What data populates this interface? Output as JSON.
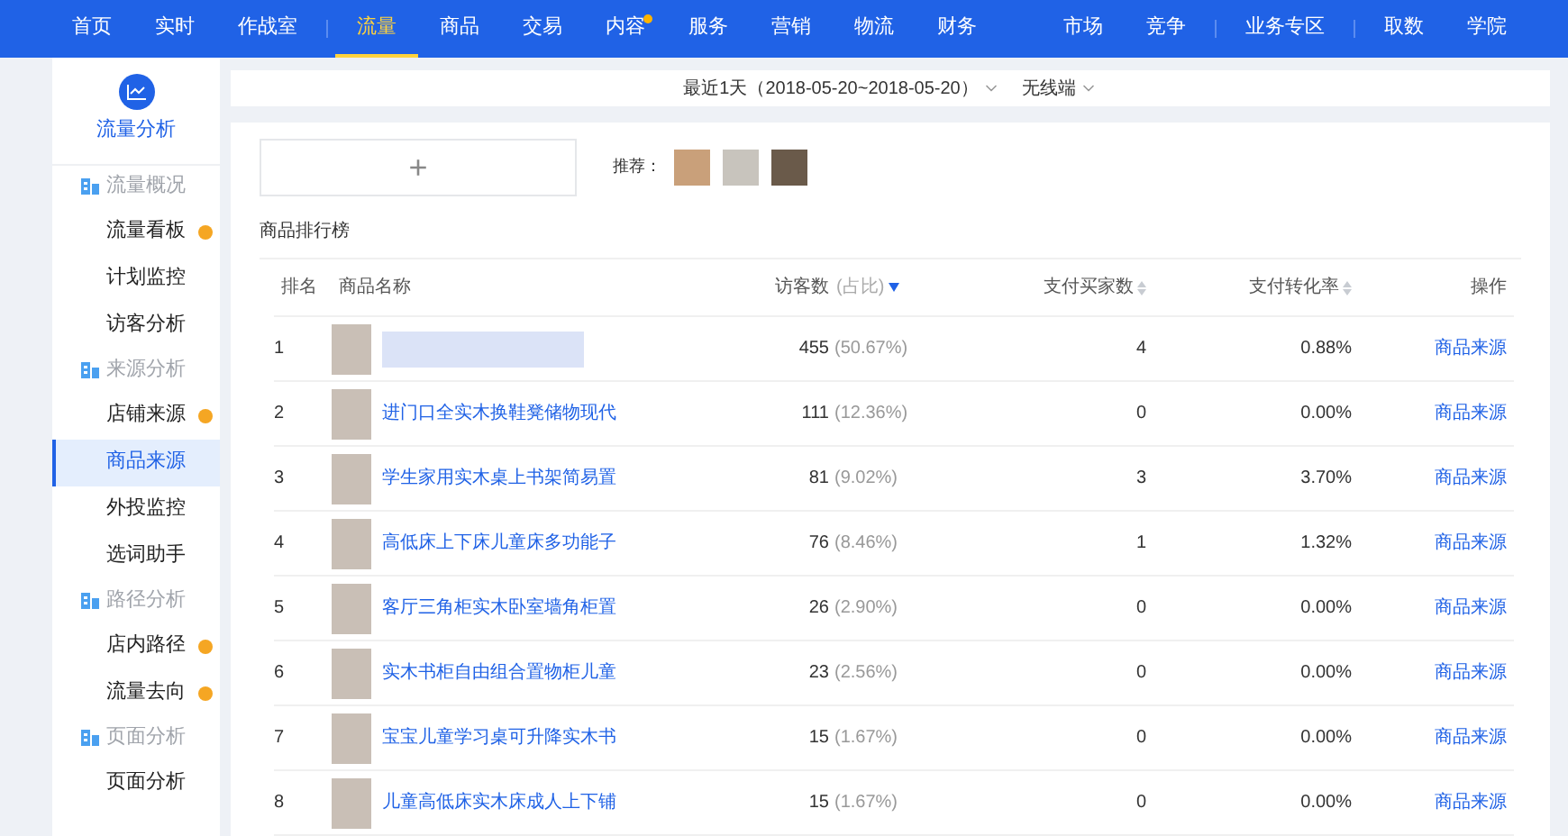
{
  "top_nav": {
    "groups": [
      [
        {
          "label": "首页",
          "selected": false,
          "dot": false
        },
        {
          "label": "实时",
          "selected": false,
          "dot": false
        },
        {
          "label": "作战室",
          "selected": false,
          "dot": false
        }
      ],
      [
        {
          "label": "流量",
          "selected": true,
          "dot": false
        },
        {
          "label": "商品",
          "selected": false,
          "dot": false
        },
        {
          "label": "交易",
          "selected": false,
          "dot": false
        },
        {
          "label": "内容",
          "selected": false,
          "dot": true
        },
        {
          "label": "服务",
          "selected": false,
          "dot": false
        },
        {
          "label": "营销",
          "selected": false,
          "dot": false
        },
        {
          "label": "物流",
          "selected": false,
          "dot": false
        },
        {
          "label": "财务",
          "selected": false,
          "dot": false
        }
      ],
      [
        {
          "label": "市场",
          "selected": false,
          "dot": false
        },
        {
          "label": "竞争",
          "selected": false,
          "dot": false
        }
      ],
      [
        {
          "label": "业务专区",
          "selected": false,
          "dot": false
        }
      ],
      [
        {
          "label": "取数",
          "selected": false,
          "dot": false
        },
        {
          "label": "学院",
          "selected": false,
          "dot": false
        }
      ]
    ],
    "dividers_after": [
      true,
      false,
      true,
      true
    ]
  },
  "sidebar": {
    "title": "流量分析",
    "sections": [
      {
        "title": "流量概况",
        "items": [
          {
            "label": "流量看板",
            "selected": false,
            "dot": true
          },
          {
            "label": "计划监控",
            "selected": false,
            "dot": false
          },
          {
            "label": "访客分析",
            "selected": false,
            "dot": false
          }
        ]
      },
      {
        "title": "来源分析",
        "items": [
          {
            "label": "店铺来源",
            "selected": false,
            "dot": true
          },
          {
            "label": "商品来源",
            "selected": true,
            "dot": false
          },
          {
            "label": "外投监控",
            "selected": false,
            "dot": false
          },
          {
            "label": "选词助手",
            "selected": false,
            "dot": false
          }
        ]
      },
      {
        "title": "路径分析",
        "items": [
          {
            "label": "店内路径",
            "selected": false,
            "dot": true
          },
          {
            "label": "流量去向",
            "selected": false,
            "dot": true
          }
        ]
      },
      {
        "title": "页面分析",
        "items": [
          {
            "label": "页面分析",
            "selected": false,
            "dot": false
          }
        ]
      }
    ]
  },
  "filter_bar": {
    "date_range": "最近1天（2018-05-20~2018-05-20）",
    "device": "无线端"
  },
  "add_button": "+",
  "recommend_label": "推荐：",
  "ranking": {
    "title": "商品排行榜",
    "columns": [
      {
        "label": "排名",
        "sortable": false,
        "sorted": false
      },
      {
        "label": "商品名称",
        "sortable": false,
        "sorted": false
      },
      {
        "label": "访客数",
        "sortable": false,
        "sorted": false
      },
      {
        "label": "(占比)",
        "sortable": true,
        "sorted": true
      },
      {
        "label": "支付买家数",
        "sortable": true,
        "sorted": false
      },
      {
        "label": "支付转化率",
        "sortable": true,
        "sorted": false
      },
      {
        "label": "操作",
        "sortable": false,
        "sorted": false
      }
    ],
    "rows": [
      {
        "rank": "1",
        "name_blurred": true,
        "name": "",
        "visitors": "455",
        "share": "(50.67%)",
        "buyers": "4",
        "conversion": "0.88%",
        "action": "商品来源"
      },
      {
        "rank": "2",
        "name_blurred": false,
        "name": "进门口全实木换鞋凳储物现代",
        "visitors": "111",
        "share": "(12.36%)",
        "buyers": "0",
        "conversion": "0.00%",
        "action": "商品来源"
      },
      {
        "rank": "3",
        "name_blurred": false,
        "name": "学生家用实木桌上书架简易置",
        "visitors": "81",
        "share": "(9.02%)",
        "buyers": "3",
        "conversion": "3.70%",
        "action": "商品来源"
      },
      {
        "rank": "4",
        "name_blurred": false,
        "name": "高低床上下床儿童床多功能子",
        "visitors": "76",
        "share": "(8.46%)",
        "buyers": "1",
        "conversion": "1.32%",
        "action": "商品来源"
      },
      {
        "rank": "5",
        "name_blurred": false,
        "name": "客厅三角柜实木卧室墙角柜置",
        "visitors": "26",
        "share": "(2.90%)",
        "buyers": "0",
        "conversion": "0.00%",
        "action": "商品来源"
      },
      {
        "rank": "6",
        "name_blurred": false,
        "name": "实木书柜自由组合置物柜儿童",
        "visitors": "23",
        "share": "(2.56%)",
        "buyers": "0",
        "conversion": "0.00%",
        "action": "商品来源"
      },
      {
        "rank": "7",
        "name_blurred": false,
        "name": "宝宝儿童学习桌可升降实木书",
        "visitors": "15",
        "share": "(1.67%)",
        "buyers": "0",
        "conversion": "0.00%",
        "action": "商品来源"
      },
      {
        "rank": "8",
        "name_blurred": false,
        "name": "儿童高低床实木床成人上下铺",
        "visitors": "15",
        "share": "(1.67%)",
        "buyers": "0",
        "conversion": "0.00%",
        "action": "商品来源"
      }
    ]
  }
}
